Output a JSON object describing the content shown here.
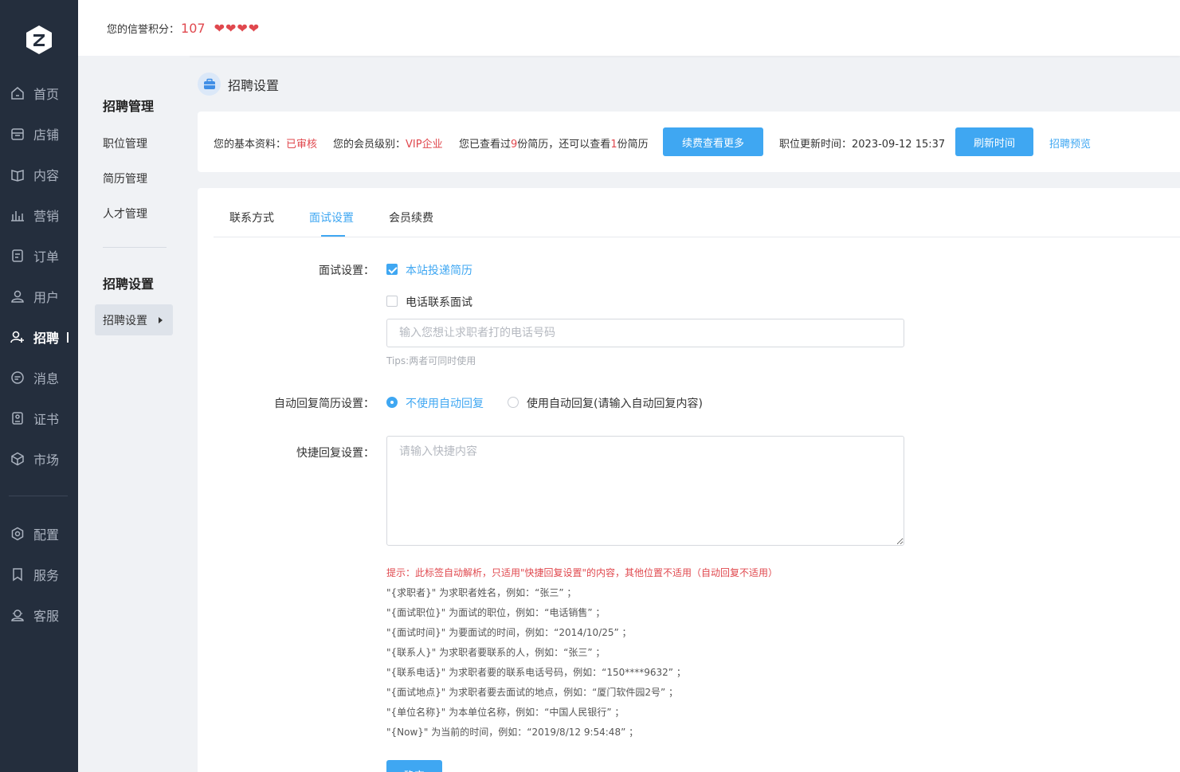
{
  "nav": {
    "items": [
      {
        "label": "首页",
        "icon": "home-icon"
      },
      {
        "label": "店铺",
        "icon": "store-icon"
      },
      {
        "label": "内容",
        "icon": "book-icon"
      },
      {
        "label": "营销",
        "icon": "chart-icon"
      },
      {
        "label": "订单",
        "icon": "order-icon"
      },
      {
        "label": "用户",
        "icon": "user-icon"
      },
      {
        "label": "招聘",
        "icon": "recruit-icon"
      },
      {
        "label": "消息",
        "icon": "message-icon"
      },
      {
        "label": "证书",
        "icon": "certificate-icon"
      },
      {
        "label": "市场",
        "icon": "market-icon"
      },
      {
        "label": "配置",
        "icon": "gear-icon"
      },
      {
        "label": "服务",
        "icon": "service-icon"
      },
      {
        "label": "客服",
        "icon": "headset-icon"
      }
    ],
    "active": "招聘"
  },
  "header": {
    "credit_label": "您的信誉积分：",
    "credit_value": "107",
    "hearts": 4
  },
  "subnav": {
    "group1_title": "招聘管理",
    "group1_items": [
      "职位管理",
      "简历管理",
      "人才管理"
    ],
    "group2_title": "招聘设置",
    "active_item": "招聘设置"
  },
  "page": {
    "title": "招聘设置"
  },
  "info": {
    "basic_label": "您的基本资料：",
    "basic_status": "已审核",
    "level_label": "您的会员级别：",
    "level_value": "VIP企业",
    "viewed_prefix": "您已查看过",
    "viewed_count": "9",
    "viewed_mid": "份简历，还可以查看",
    "remain_count": "1",
    "viewed_suffix": "份简历",
    "renew_button": "续费查看更多",
    "update_label": "职位更新时间：",
    "update_time": "2023-09-12 15:37",
    "refresh_button": "刷新时间",
    "preview_link": "招聘预览"
  },
  "tabs": [
    "联系方式",
    "面试设置",
    "会员续费"
  ],
  "active_tab": "面试设置",
  "form": {
    "interview_label": "面试设置：",
    "opt_site": "本站投递简历",
    "opt_site_checked": true,
    "opt_phone": "电话联系面试",
    "opt_phone_checked": false,
    "phone_placeholder": "输入您想让求职者打的电话号码",
    "tips": "Tips:两者可同时使用",
    "auto_label": "自动回复简历设置：",
    "auto_off": "不使用自动回复",
    "auto_on": "使用自动回复(请输入自动回复内容)",
    "auto_selected": "不使用自动回复",
    "quick_label": "快捷回复设置：",
    "quick_placeholder": "请输入快捷内容",
    "hint_title": "提示：此标签自动解析，只适用\"快捷回复设置\"的内容，其他位置不适用（自动回复不适用）",
    "hints": [
      "\"{求职者}\" 为求职者姓名，例如：“张三” ；",
      "\"{面试职位}\" 为面试的职位，例如：“电话销售” ；",
      "\"{面试时间}\" 为要面试的时间，例如：“2014/10/25” ；",
      "\"{联系人}\" 为求职者要联系的人，例如：“张三” ；",
      "\"{联系电话}\" 为求职者要的联系电话号码，例如：“150****9632” ；",
      "\"{面试地点}\" 为求职者要去面试的地点，例如：“厦门软件园2号” ；",
      "\"{单位名称}\" 为本单位名称，例如：“中国人民银行” ；",
      "\"{Now}\" 为当前的时间，例如：“2019/8/12 9:54:48” ；"
    ],
    "submit_label": "确定"
  },
  "colors": {
    "accent": "#3fa7f2",
    "danger": "#e0484e",
    "nav_bg": "#242e3d"
  }
}
